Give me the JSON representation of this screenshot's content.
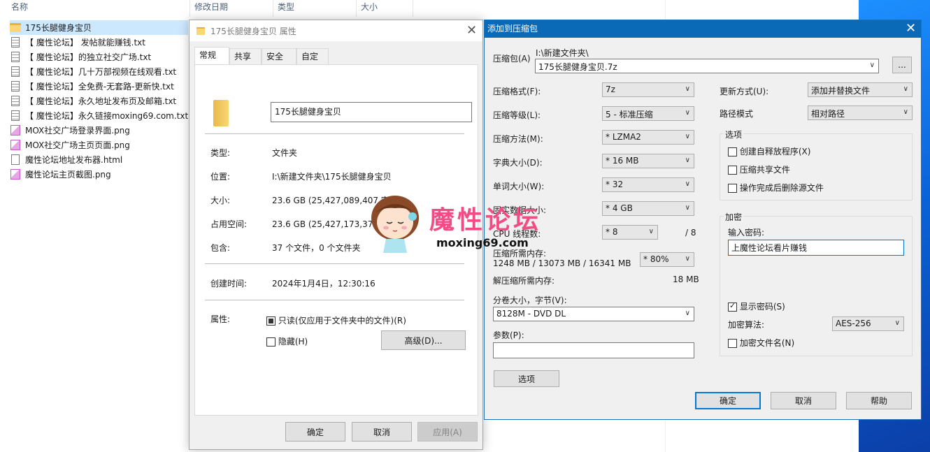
{
  "explorer": {
    "columns": [
      "名称",
      "修改日期",
      "类型",
      "大小"
    ],
    "files": [
      {
        "name": "175长腿健身宝贝",
        "icon": "folder-icon",
        "selected": true
      },
      {
        "name": "【 魔性论坛】 发帖就能赚钱.txt",
        "icon": "text-file-icon"
      },
      {
        "name": "【 魔性论坛】的独立社交广场.txt",
        "icon": "text-file-icon"
      },
      {
        "name": "【 魔性论坛】几十万部视频在线观看.txt",
        "icon": "text-file-icon"
      },
      {
        "name": "【 魔性论坛】全免费-无套路-更新快.txt",
        "icon": "text-file-icon"
      },
      {
        "name": "【 魔性论坛】永久地址发布页及邮箱.txt",
        "icon": "text-file-icon"
      },
      {
        "name": "【 魔性论坛】永久链接moxing69.com.txt",
        "icon": "text-file-icon"
      },
      {
        "name": "MOX社交广场登录界面.png",
        "icon": "image-file-icon"
      },
      {
        "name": "MOX社交广场主页页面.png",
        "icon": "image-file-icon"
      },
      {
        "name": "魔性论坛地址发布器.html",
        "icon": "html-file-icon"
      },
      {
        "name": "魔性论坛主页截图.png",
        "icon": "image-file-icon"
      }
    ]
  },
  "properties": {
    "title": "175长腿健身宝贝 属性",
    "tabs": [
      "常规",
      "共享",
      "安全",
      "自定义"
    ],
    "folder_name": "175长腿健身宝贝",
    "rows": {
      "type_label": "类型:",
      "type_value": "文件夹",
      "location_label": "位置:",
      "location_value": "I:\\新建文件夹\\175长腿健身宝贝",
      "size_label": "大小:",
      "size_value": "23.6 GB (25,427,089,407 字节)",
      "disk_label": "占用空间:",
      "disk_value": "23.6 GB (25,427,173,376 字节)",
      "contains_label": "包含:",
      "contains_value": "37 个文件，0 个文件夹",
      "created_label": "创建时间:",
      "created_value": "2024年1月4日，12:30:16",
      "attributes_label": "属性:"
    },
    "readonly_label": "只读(仅应用于文件夹中的文件)(R)",
    "hidden_label": "隐藏(H)",
    "advanced_button": "高级(D)...",
    "ok": "确定",
    "cancel": "取消",
    "apply": "应用(A)"
  },
  "zip": {
    "title": "添加到压缩包",
    "archive_label": "压缩包(A)",
    "archive_path": "I:\\新建文件夹\\",
    "archive_name": "175长腿健身宝贝.7z",
    "browse": "...",
    "format_label": "压缩格式(F):",
    "format_value": "7z",
    "level_label": "压缩等级(L):",
    "level_value": "5 - 标准压缩",
    "method_label": "压缩方法(M):",
    "method_value": "* LZMA2",
    "dict_label": "字典大小(D):",
    "dict_value": "* 16 MB",
    "word_label": "单词大小(W):",
    "word_value": "* 32",
    "solid_label": "固实数据大小:",
    "solid_value": "* 4 GB",
    "cpu_label": "CPU 线程数:",
    "cpu_value": "* 8",
    "cpu_total": "/ 8",
    "mem_label": "压缩所需内存:",
    "mem_value": "1248 MB / 13073 MB / 16341 MB",
    "mem_percent": "* 80%",
    "decomp_label": "解压缩所需内存:",
    "decomp_value": "18 MB",
    "split_label": "分卷大小，字节(V):",
    "split_value": "8128M - DVD DL",
    "params_label": "参数(P):",
    "params_value": "",
    "options_button": "选项",
    "update_label": "更新方式(U):",
    "update_value": "添加并替换文件",
    "path_label": "路径模式",
    "path_value": "相对路径",
    "options_group": "选项",
    "sfx_label": "创建自释放程序(X)",
    "shared_label": "压缩共享文件",
    "delete_label": "操作完成后删除源文件",
    "encrypt_group": "加密",
    "password_label": "输入密码:",
    "password_value": "上魔性论坛看片赚钱",
    "show_password_label": "显示密码(S)",
    "enc_method_label": "加密算法:",
    "enc_method_value": "AES-256",
    "enc_names_label": "加密文件名(N)",
    "ok": "确定",
    "cancel": "取消",
    "help": "帮助"
  },
  "watermark": {
    "text": "魔性论坛",
    "url": "moxing69.com"
  },
  "colors": {
    "accent": "#0b6ab7",
    "selection": "#cce8ff",
    "watermark": "#ef4d83",
    "desktop": "#0a64d8"
  }
}
